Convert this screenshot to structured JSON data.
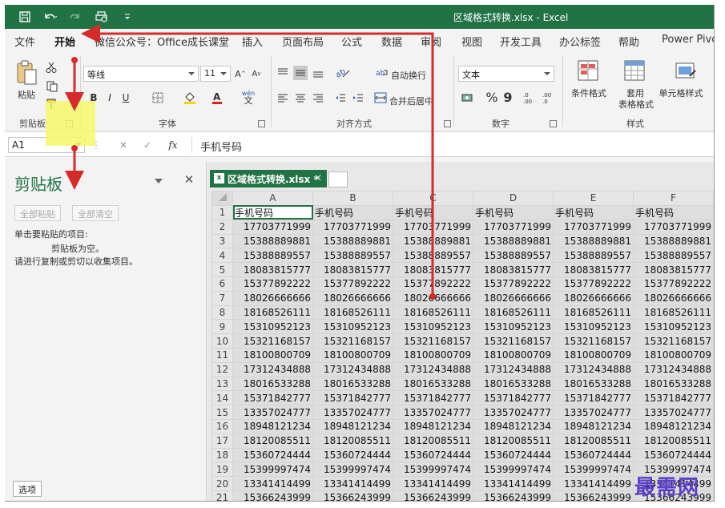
{
  "window": {
    "title": "区域格式转换.xlsx  -  Excel"
  },
  "tabs": [
    "文件",
    "开始",
    "微信公众号：Office成长课堂",
    "插入",
    "页面布局",
    "公式",
    "数据",
    "审阅",
    "视图",
    "开发工具",
    "办公标签",
    "帮助",
    "Power Pivo"
  ],
  "active_tab": "开始",
  "ribbon": {
    "clipboard": {
      "paste_label": "粘贴",
      "group_label": "剪贴板"
    },
    "font": {
      "font_name": "等线",
      "font_size": "11",
      "bold": "B",
      "italic": "I",
      "underline": "U",
      "group_label": "字体"
    },
    "alignment": {
      "wrap_text": "自动换行",
      "merge_center": "合并后居中",
      "group_label": "对齐方式"
    },
    "number": {
      "format": "文本",
      "percent": "%",
      "comma": "9",
      "group_label": "数字"
    },
    "styles": {
      "conditional": "条件格式",
      "table_format_1": "套用",
      "table_format_2": "表格格式",
      "cell_styles": "单元格样式",
      "group_label": "样式"
    }
  },
  "formula_bar": {
    "name_box": "A1",
    "fx": "fx",
    "content": "手机号码"
  },
  "clipboard_pane": {
    "title": "剪贴板",
    "paste_all": "全部粘贴",
    "clear_all": "全部清空",
    "instruction": "单击要粘贴的项目:",
    "empty_msg": "剪贴板为空。",
    "hint": "请进行复制或剪切以收集项目。",
    "options": "选项"
  },
  "workbook_tab": {
    "name": "区域格式转换.xlsx *",
    "icon_letter": "x"
  },
  "sheet": {
    "columns": [
      "A",
      "B",
      "C",
      "D",
      "E",
      "F"
    ],
    "header_value": "手机号码",
    "rows": [
      {
        "n": "1",
        "v": "手机号码"
      },
      {
        "n": "2",
        "v": "17703771999"
      },
      {
        "n": "3",
        "v": "15388889881"
      },
      {
        "n": "4",
        "v": "15388889557"
      },
      {
        "n": "5",
        "v": "18083815777"
      },
      {
        "n": "6",
        "v": "15377892222"
      },
      {
        "n": "7",
        "v": "18026666666"
      },
      {
        "n": "8",
        "v": "18168526111"
      },
      {
        "n": "9",
        "v": "15310952123"
      },
      {
        "n": "10",
        "v": "15321168157"
      },
      {
        "n": "11",
        "v": "18100800709"
      },
      {
        "n": "12",
        "v": "17312434888"
      },
      {
        "n": "13",
        "v": "18016533288"
      },
      {
        "n": "14",
        "v": "15371842777"
      },
      {
        "n": "15",
        "v": "13357024777"
      },
      {
        "n": "16",
        "v": "18948121234"
      },
      {
        "n": "17",
        "v": "18120085511"
      },
      {
        "n": "18",
        "v": "15360724444"
      },
      {
        "n": "19",
        "v": "15399997474"
      },
      {
        "n": "20",
        "v": "13341414499"
      },
      {
        "n": "21",
        "v": "15366243999"
      }
    ]
  },
  "watermark": "最需网",
  "colors": {
    "excel_green": "#217346",
    "arrow_red": "#d62b2b",
    "highlight_yellow": "#f5f76a"
  }
}
